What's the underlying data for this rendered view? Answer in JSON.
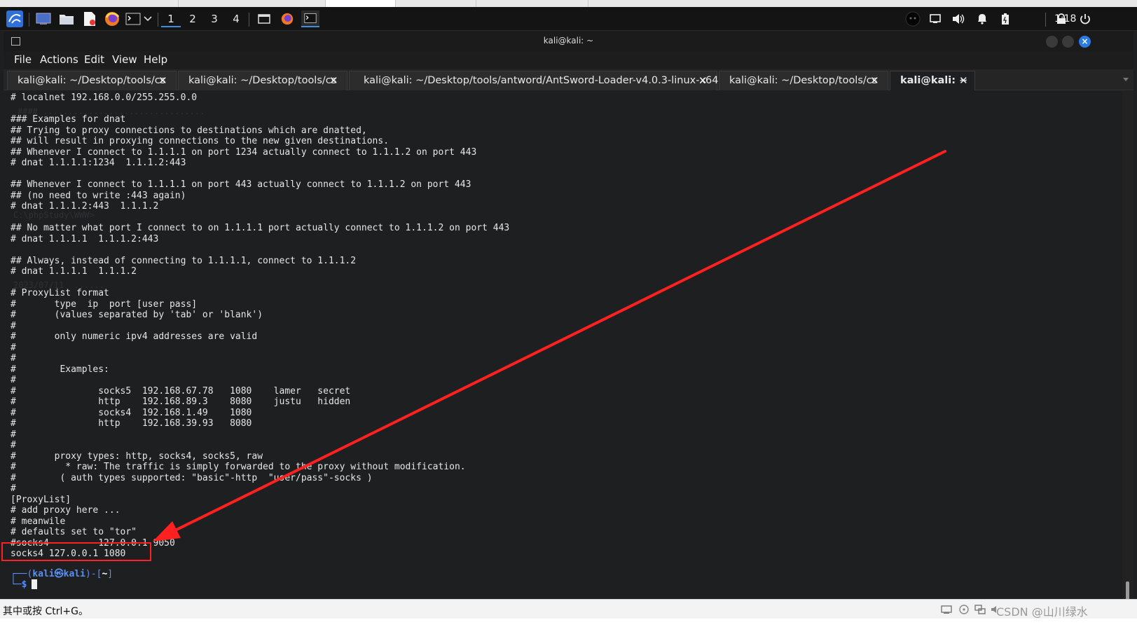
{
  "panel": {
    "workspaces": [
      "1",
      "2",
      "3",
      "4"
    ],
    "active_workspace": "1",
    "clock": "1:18"
  },
  "window": {
    "title": "kali@kali: ~"
  },
  "menu": {
    "items": [
      "File",
      "Actions",
      "Edit",
      "View",
      "Help"
    ]
  },
  "tabs": [
    {
      "label": "kali@kali: ~/Desktop/tools/cs",
      "active": false
    },
    {
      "label": "kali@kali: ~/Desktop/tools/cs",
      "active": false
    },
    {
      "label": "kali@kali: ~/Desktop/tools/antword/AntSword-Loader-v4.0.3-linux-x64",
      "active": false
    },
    {
      "label": "kali@kali: ~/Desktop/tools/cs",
      "active": false
    },
    {
      "label": "kali@kali: ~",
      "active": true
    }
  ],
  "terminal": {
    "lines": [
      "# localnet 192.168.0.0/255.255.0.0",
      "",
      "### Examples for dnat",
      "## Trying to proxy connections to destinations which are dnatted,",
      "## will result in proxying connections to the new given destinations.",
      "## Whenever I connect to 1.1.1.1 on port 1234 actually connect to 1.1.1.2 on port 443",
      "# dnat 1.1.1.1:1234  1.1.1.2:443",
      "",
      "## Whenever I connect to 1.1.1.1 on port 443 actually connect to 1.1.1.2 on port 443",
      "## (no need to write :443 again)",
      "# dnat 1.1.1.2:443  1.1.1.2",
      "",
      "## No matter what port I connect to on 1.1.1.1 port actually connect to 1.1.1.2 on port 443",
      "# dnat 1.1.1.1  1.1.1.2:443",
      "",
      "## Always, instead of connecting to 1.1.1.1, connect to 1.1.1.2",
      "# dnat 1.1.1.1  1.1.1.2",
      "",
      "# ProxyList format",
      "#       type  ip  port [user pass]",
      "#       (values separated by 'tab' or 'blank')",
      "#",
      "#       only numeric ipv4 addresses are valid",
      "#",
      "#",
      "#        Examples:",
      "#",
      "#               socks5  192.168.67.78   1080    lamer   secret",
      "#               http    192.168.89.3    8080    justu   hidden",
      "#               socks4  192.168.1.49    1080",
      "#               http    192.168.39.93   8080",
      "#",
      "#",
      "#       proxy types: http, socks4, socks5, raw",
      "#         * raw: The traffic is simply forwarded to the proxy without modification.",
      "#        ( auth types supported: \"basic\"-http  \"user/pass\"-socks )",
      "#",
      "[ProxyList]",
      "# add proxy here ...",
      "# meanwile",
      "# defaults set to \"tor\"",
      "#socks4         127.0.0.1 9050",
      "socks4 127.0.0.1 1080"
    ],
    "prompt_user": "kali",
    "prompt_at": "㉿",
    "prompt_host": "kali",
    "prompt_dir": "~",
    "prompt_symbol": "$"
  },
  "status": {
    "hint": "其中或按 Ctrl+G。",
    "watermark": "CSDN @山川绿水"
  },
  "colors": {
    "accent_blue": "#2d7be0",
    "annotation_red": "#ff2020",
    "prompt_blue": "#5b8ff2"
  }
}
